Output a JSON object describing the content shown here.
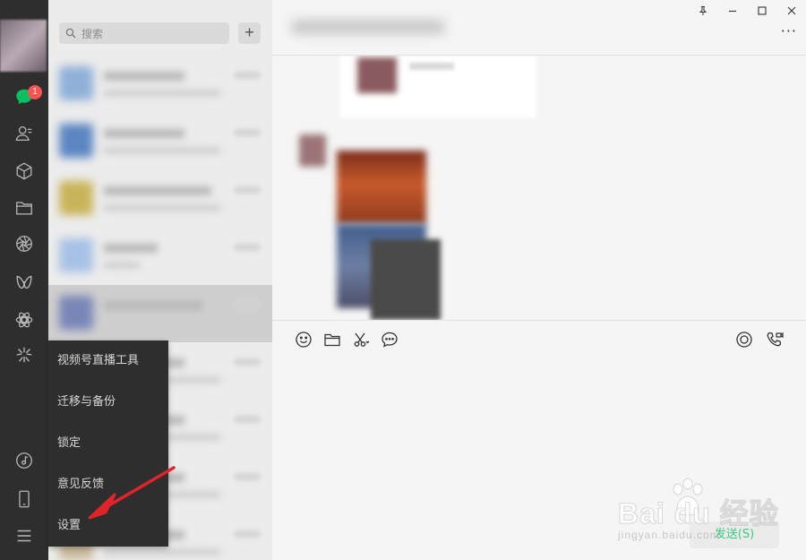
{
  "sidebar": {
    "badge_count": "1",
    "icons": [
      "chat-icon",
      "contacts-icon",
      "favorites-icon",
      "folder-icon",
      "moments-icon",
      "channels-icon",
      "mini-programs-icon",
      "live-icon",
      "music-icon",
      "phone-icon",
      "menu-icon"
    ]
  },
  "search": {
    "placeholder": "搜索",
    "add_label": "+"
  },
  "menu": {
    "items": [
      "视频号直播工具",
      "迁移与备份",
      "锁定",
      "意见反馈",
      "设置"
    ]
  },
  "chat": {
    "more_label": "···",
    "send_label": "发送(S)"
  },
  "watermark": {
    "brand": "Bai du 经验",
    "url": "jingyan.baidu.com"
  },
  "colors": {
    "sidebar_bg": "#2e2e2e",
    "badge": "#fa5151",
    "accent_green": "#07c160",
    "arrow": "#e0242a"
  }
}
